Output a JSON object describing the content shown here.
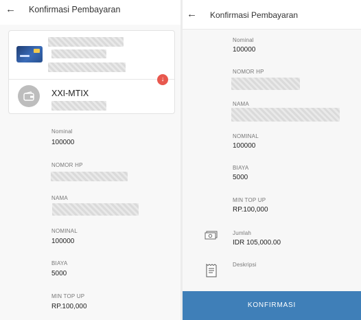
{
  "left": {
    "title": "Konfirmasi Pembayaran",
    "back_icon": "←",
    "merchant_name": "XXI-MTIX",
    "fields": [
      {
        "label": "Nominal",
        "value": "100000"
      },
      {
        "label": "NOMOR HP",
        "value": ""
      },
      {
        "label": "NAMA",
        "value": ""
      },
      {
        "label": "NOMINAL",
        "value": "100000"
      },
      {
        "label": "BIAYA",
        "value": "5000"
      },
      {
        "label": "MIN TOP UP",
        "value": "RP.100,000"
      }
    ]
  },
  "right": {
    "title": "Konfirmasi Pembayaran",
    "back_icon": "←",
    "fields": [
      {
        "label": "Nominal",
        "value": "100000"
      },
      {
        "label": "NOMOR HP",
        "value": ""
      },
      {
        "label": "NAMA",
        "value": ""
      },
      {
        "label": "NOMINAL",
        "value": "100000"
      },
      {
        "label": "BIAYA",
        "value": "5000"
      },
      {
        "label": "MIN TOP UP",
        "value": "RP.100,000"
      }
    ],
    "jumlah_label": "Jumlah",
    "jumlah_value": "IDR 105,000.00",
    "deskripsi_label": "Deskripsi",
    "confirm_button": "KONFIRMASI"
  },
  "colors": {
    "primary_button": "#3f7fb8",
    "download_badge": "#e8584e"
  },
  "icons": [
    "back-arrow-icon",
    "credit-card-icon",
    "download-icon",
    "wallet-icon",
    "money-icon",
    "receipt-icon"
  ]
}
